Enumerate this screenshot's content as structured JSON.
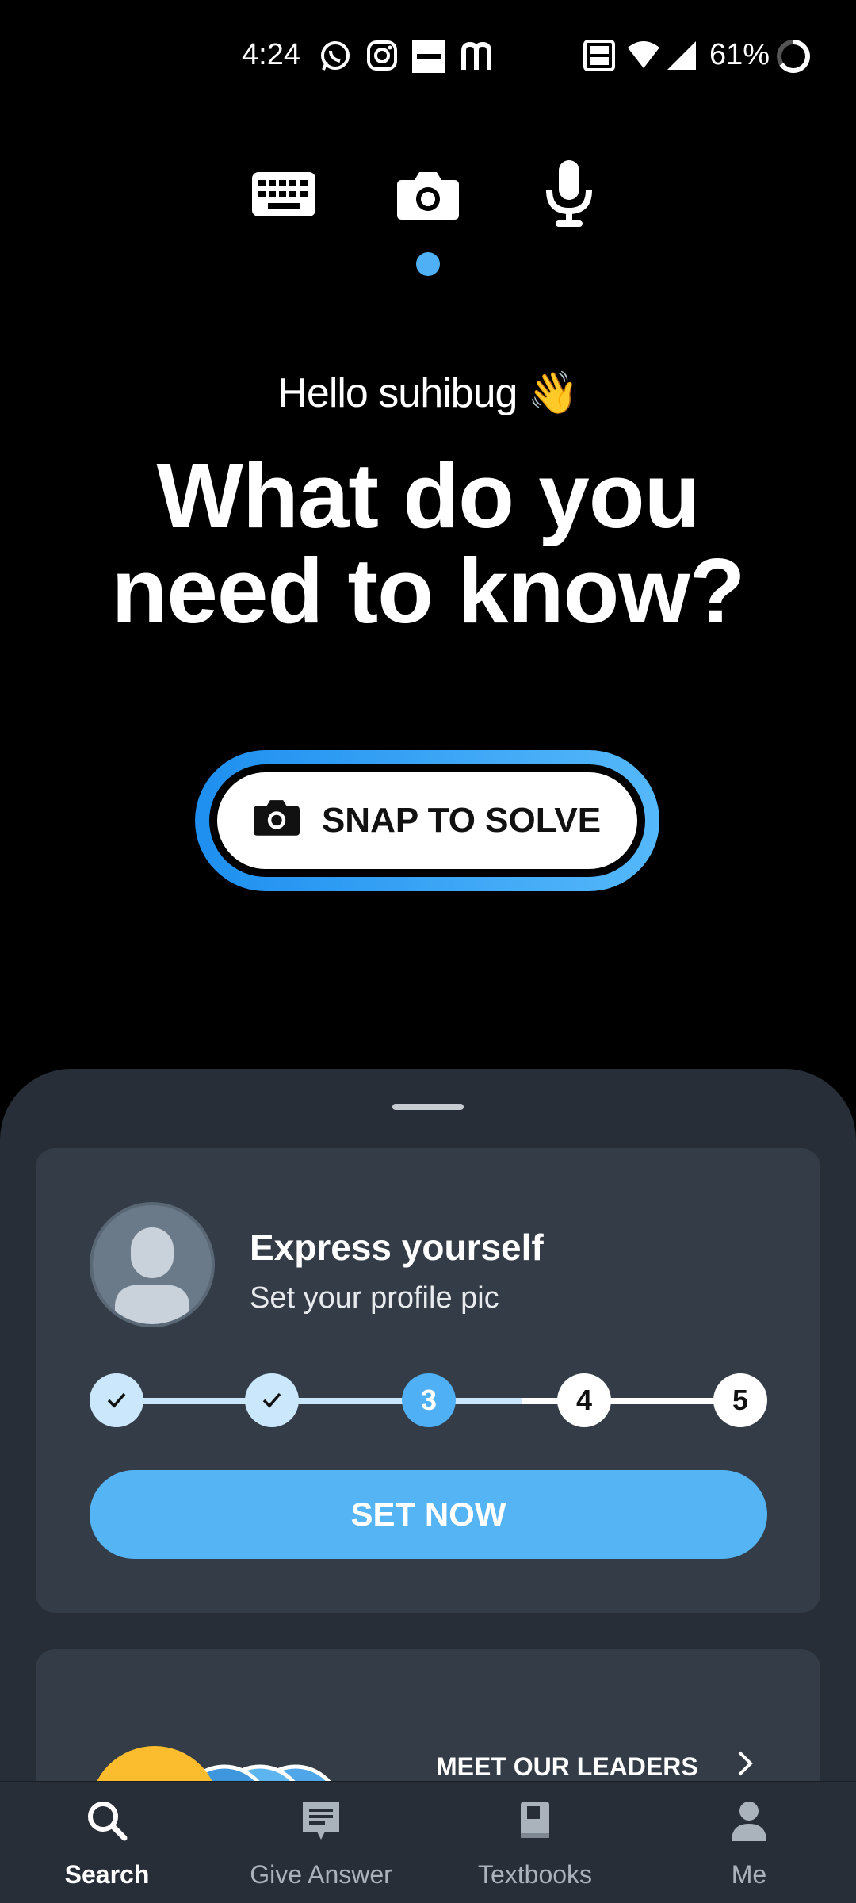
{
  "status_bar": {
    "time": "4:24",
    "battery": "61%",
    "icons": [
      "whatsapp-icon",
      "instagram-icon",
      "zomato-icon",
      "m-app-icon",
      "volte-icon",
      "wifi-icon",
      "signal-icon",
      "battery-icon"
    ]
  },
  "input_modes": {
    "items": [
      "keyboard-icon",
      "camera-icon",
      "microphone-icon"
    ],
    "selected": "camera-icon"
  },
  "greeting": "Hello suhibug 👋",
  "headline_line1": "What do you",
  "headline_line2": "need to know?",
  "snap_button_label": "SNAP TO SOLVE",
  "profile_card": {
    "title": "Express yourself",
    "subtitle": "Set your profile pic",
    "steps": [
      {
        "label": "",
        "state": "done"
      },
      {
        "label": "",
        "state": "done"
      },
      {
        "label": "3",
        "state": "current"
      },
      {
        "label": "4",
        "state": "todo"
      },
      {
        "label": "5",
        "state": "todo"
      }
    ],
    "button_label": "SET NOW"
  },
  "leaders_card": {
    "label": "MEET OUR LEADERS"
  },
  "bottom_nav": [
    {
      "label": "Search",
      "icon": "search-icon",
      "active": true
    },
    {
      "label": "Give Answer",
      "icon": "answer-icon",
      "active": false
    },
    {
      "label": "Textbooks",
      "icon": "book-icon",
      "active": false
    },
    {
      "label": "Me",
      "icon": "person-icon",
      "active": false
    }
  ],
  "colors": {
    "accent": "#4fb0f5",
    "sheet": "#272e37",
    "card": "#333c47"
  }
}
